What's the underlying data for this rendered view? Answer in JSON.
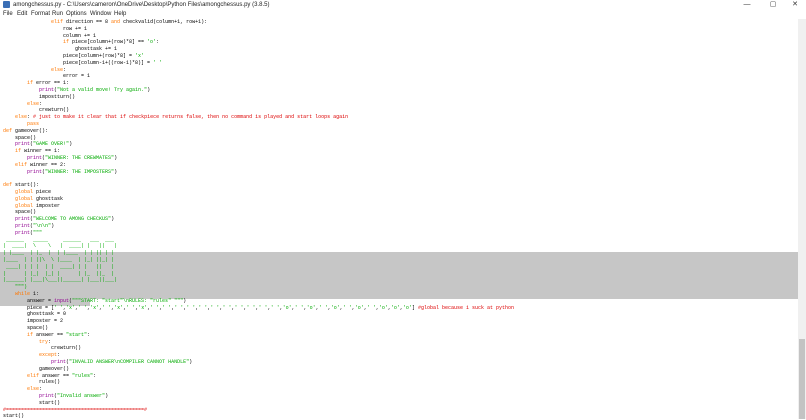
{
  "window": {
    "title": "amongchessus.py - C:\\Users\\cameron\\OneDrive\\Desktop\\Python Files\\amongchessus.py (3.8.5)",
    "minimize": "—",
    "maximize": "▢",
    "close": "✕"
  },
  "menu": [
    "File",
    "Edit",
    "Format",
    "Run",
    "Options",
    "Window",
    "Help"
  ],
  "colors": {
    "keyword": "#ff7700",
    "string": "#00aa00",
    "comment": "#dd0000",
    "builtin": "#900090",
    "definition": "#0000ff",
    "selection": "#c6c6c6"
  },
  "code_lines": [
    "                elif direction == 8 and checkvalid(column+1, row+1):",
    "                    row += 1",
    "                    column += 1",
    "                    if piece[column+(row)*8] == 'o':",
    "                        ghosttask += 1",
    "                    piece[column+(row)*8] = 'x'",
    "                    piece[column-1+((row-1)*8)] = ' '",
    "                else:",
    "                    error = 1",
    "        if error == 1:",
    "            print(\"Not a valid move! Try again.\")",
    "            impostturn()",
    "        else:",
    "            crewturn()",
    "    else: # just to make it clear that if checkpiece returns false, then no command is played and start loops again",
    "        pass",
    "def gameover():",
    "    space()",
    "    print(\"GAME OVER!\")",
    "    if winner == 1:",
    "        print(\"WINNER: THE CREWMATES\")",
    "    elif winner == 2:",
    "        print(\"WINNER: THE IMPOSTERS\")",
    "",
    "def start():",
    "    global piece",
    "    global ghosttask",
    "    global imposter",
    "    space()",
    "    print(\"WELCOME TO AMONG CHECKUS\")",
    "    print(\"\\n\\n\")",
    "    print(\"\"\"",
    " ______   _____     ______   ___  ___",
    "|  ____|  \\    \\   |  ____| |   ||   |",
    "| |____  | |_  |  | |____  | | || | |",
    "|____  | | ||\\  \\ |____  | |_| ||_| |",
    " ____| | | |  | |  ____| | |   ||   |",
    "|      | |_|  |_| |      | |_  ||_  |",
    "|______| |___|\\___||______| |___||___|",
    "    \"\"\")",
    "    while 1:",
    "        answer = input(\"\"\"START: \"start\"\\nRULES: \"rules\" \"\"\")",
    "        piece = [' ','x',' ','x',' ','x',' ','x',' ',' ',' ',' ',' ',' ',' ',' ',' ',' ',' ','o',' ','o',' ','o',' ','o',' ','o','o','o'] #global because i suck at python",
    "        ghosttask = 0",
    "        imposter = 2",
    "        space()",
    "        if answer == \"start\":",
    "            try:",
    "                crewturn()",
    "            except:",
    "                print(\"INVALID ANSWER\\nCOMPILER CANNOT HANDLE\")",
    "            gameover()",
    "        elif answer == \"rules\":",
    "            rules()",
    "        else:",
    "            print(\"Invalid answer\")",
    "            start()",
    "#==============================================#",
    "start()"
  ]
}
